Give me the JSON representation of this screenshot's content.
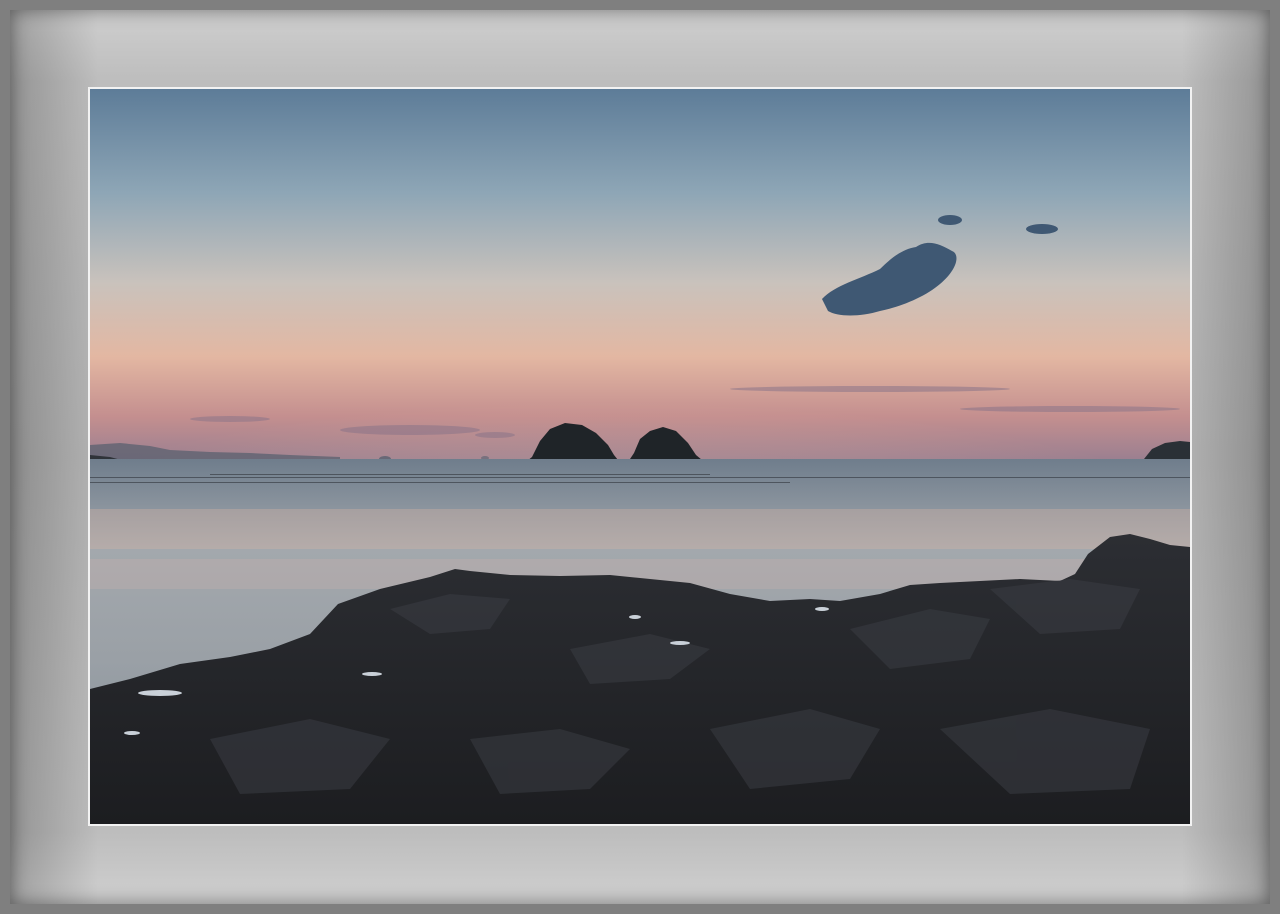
{
  "scene": {
    "subject": "sunset-seascape",
    "colors": {
      "sky_top": "#5f7f9a",
      "sky_mid": "#9fb3bd",
      "sky_glow": "#e7b9a0",
      "horizon": "#b87d86",
      "sea": "#8e9aa4",
      "rocks": "#24262a",
      "mat": "#b8b8b8",
      "frame": "#7f7f7f"
    }
  }
}
